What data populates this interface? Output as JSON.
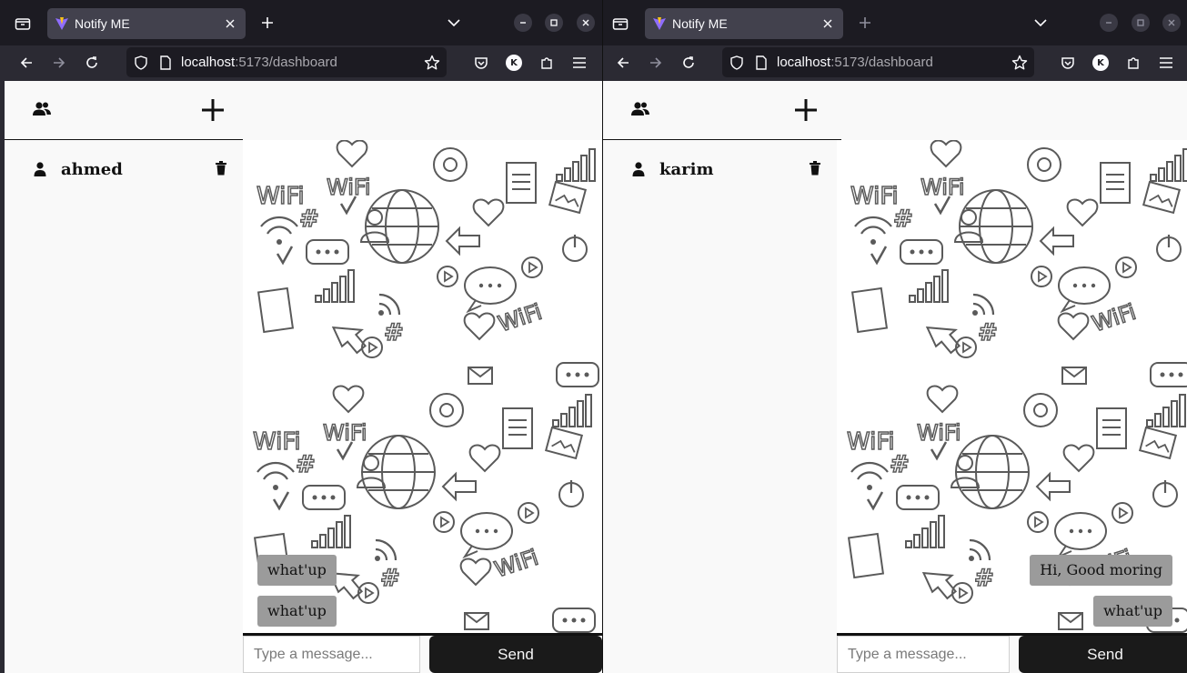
{
  "colors": {
    "tabstrip": "#1c1b22",
    "toolbar": "#2b2a33",
    "page_bg": "#f9f9f9",
    "bubble": "#9b9b9b",
    "send_button": "#1a1a1a"
  },
  "windows": [
    {
      "tab_title": "Notify ME",
      "url_host": "localhost",
      "url_rest": ":5173/dashboard",
      "profile_initial": "K",
      "contact_name": "ahmed",
      "messages": [
        "what'up",
        "what'up"
      ],
      "message_align": "left",
      "input_placeholder": "Type a message...",
      "send_label": "Send"
    },
    {
      "tab_title": "Notify ME",
      "url_host": "localhost",
      "url_rest": ":5173/dashboard",
      "profile_initial": "K",
      "contact_name": "karim",
      "messages": [
        "Hi, Good moring",
        "what'up"
      ],
      "message_align": "right",
      "input_placeholder": "Type a message...",
      "send_label": "Send"
    }
  ],
  "icons": {
    "tab_list": "tab-list-icon",
    "favicon": "vite-favicon-icon",
    "close_tab": "close-icon",
    "new_tab": "plus-icon",
    "list_all_tabs": "chevron-down-icon",
    "minimize": "minimize-icon",
    "maximize": "maximize-icon",
    "close_window": "close-icon",
    "back": "back-arrow-icon",
    "forward": "forward-arrow-icon",
    "reload": "reload-icon",
    "tracking_protection": "shield-icon",
    "page_info": "page-icon",
    "bookmark": "star-icon",
    "pocket": "pocket-icon",
    "extensions": "puzzle-icon",
    "menu": "hamburger-icon",
    "users": "users-icon",
    "add": "plus-icon",
    "person": "person-icon",
    "delete": "trash-icon"
  }
}
